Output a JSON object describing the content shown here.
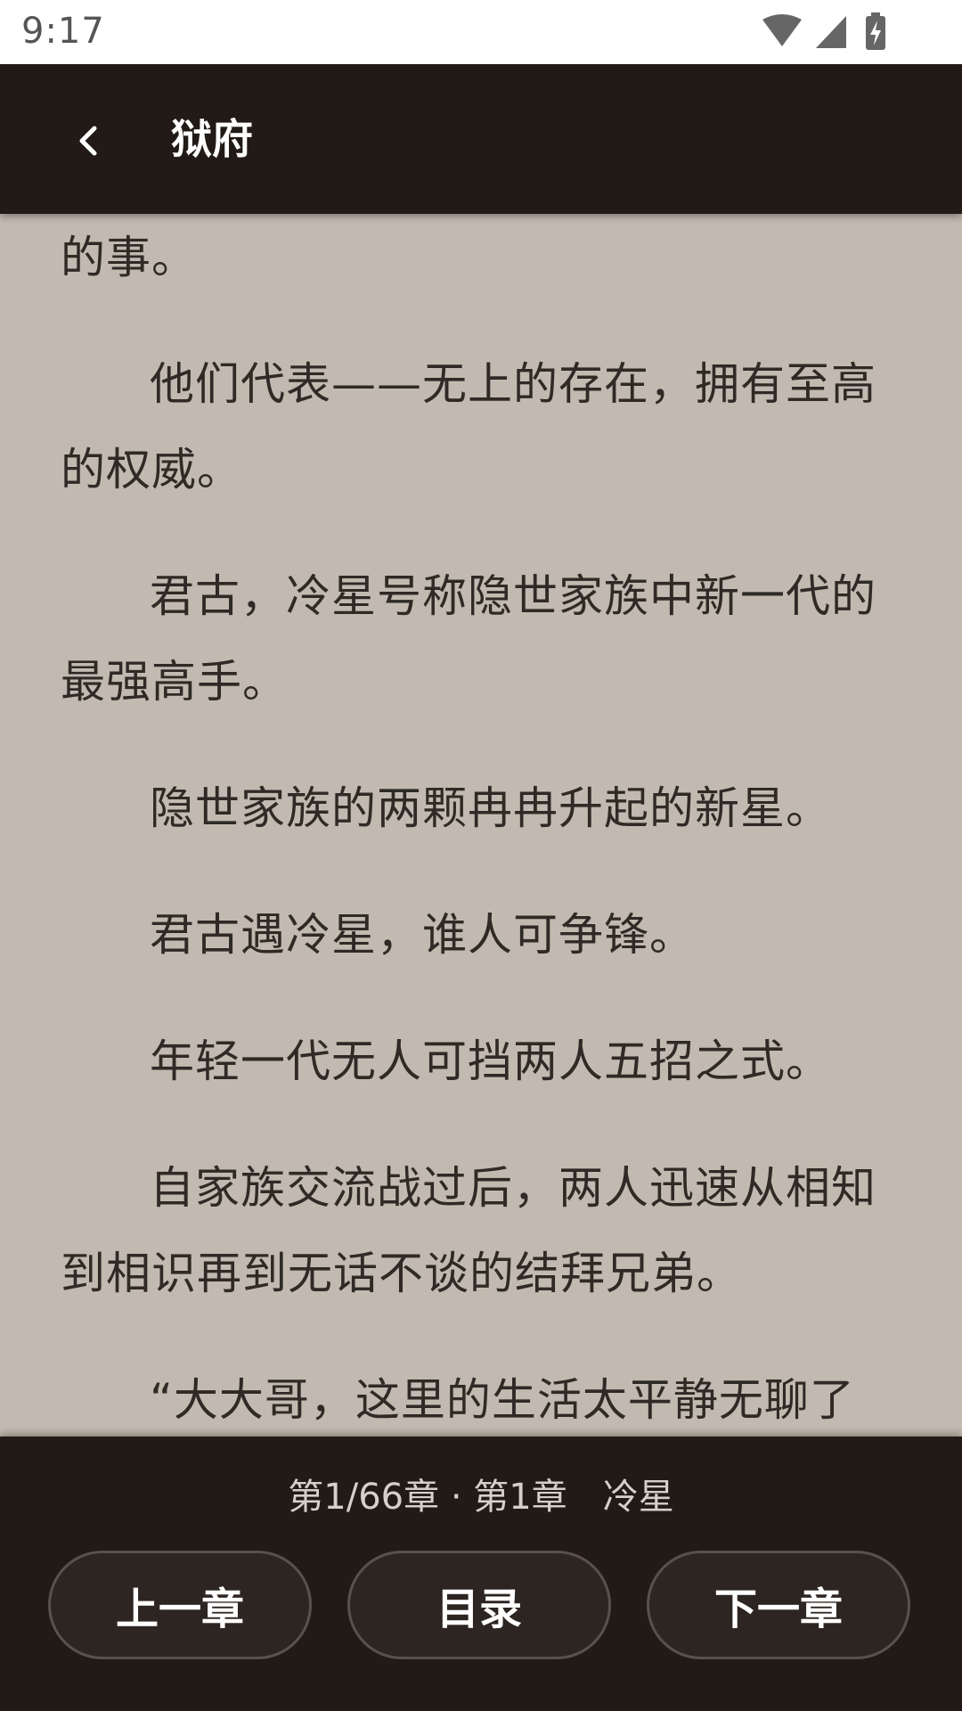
{
  "status_bar": {
    "time": "9:17",
    "icons": [
      "wifi-icon",
      "cell-signal-icon",
      "battery-charging-icon"
    ]
  },
  "app_bar": {
    "back_icon": "chevron-left-icon",
    "title": "狱府"
  },
  "reader": {
    "paragraphs": [
      "破灭一个王朝，改朝换代也不过是一句话的事。",
      "他们代表——无上的存在，拥有至高的权威。",
      "君古，冷星号称隐世家族中新一代的最强高手。",
      "隐世家族的两颗冉冉升起的新星。",
      "君古遇冷星，谁人可争锋。",
      "年轻一代无人可挡两人五招之式。",
      "自家族交流战过后，两人迅速从相知到相识再到无话不谈的结拜兄弟。",
      "“大大哥，这里的生活太平静无聊了"
    ]
  },
  "bottom_bar": {
    "chapter_info": "第1/66章 · 第1章　冷星",
    "prev_label": "上一章",
    "toc_label": "目录",
    "next_label": "下一章"
  },
  "colors": {
    "status_bar_bg": "#ffffff",
    "app_bar_bg": "#211a16",
    "page_bg": "#c2bab0",
    "text": "#2f2a26",
    "button_bg": "#2c2521",
    "button_border": "#5a514b"
  }
}
